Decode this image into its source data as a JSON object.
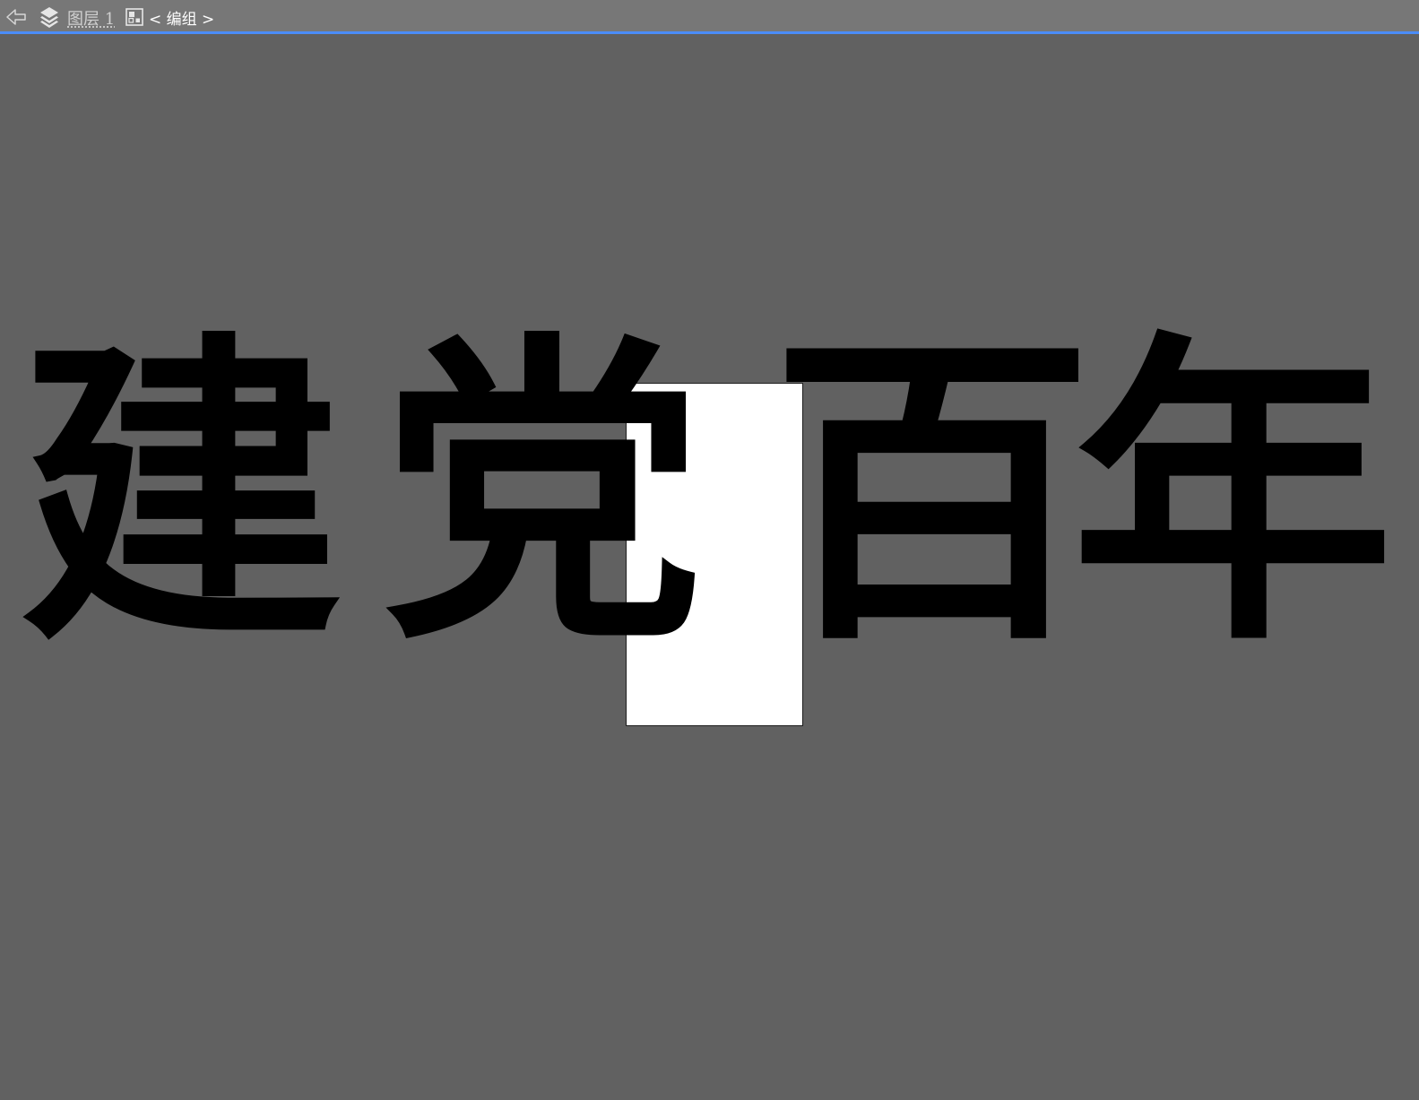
{
  "toolbar": {
    "back_icon": "arrow-left-outline-icon",
    "layers_icon": "layers-stack-icon",
    "layer_name": "图层 1",
    "group_icon": "group-grid-icon",
    "group_label": "< 编组 >"
  },
  "canvas": {
    "background": "#616161",
    "artboard_color": "#ffffff",
    "accent_line": "#4b8df8",
    "calligraphy_characters": [
      "建",
      "党",
      "百",
      "年"
    ]
  }
}
